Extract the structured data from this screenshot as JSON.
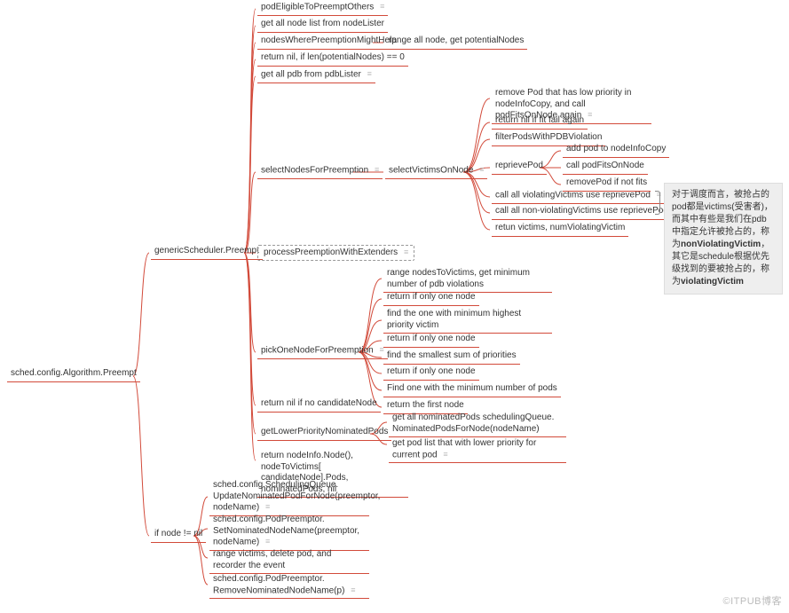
{
  "root": {
    "label": "sched.config.Algorithm.Preempt"
  },
  "level1": {
    "generic": {
      "label": "genericScheduler.Preempt"
    },
    "ifnode": {
      "label": "if node != nil"
    }
  },
  "generic_children": {
    "podEligible": "podEligibleToPreemptOthers",
    "getNodeList": "get all node list from nodeLister",
    "nodesWhere": "nodesWherePreemptionMightHelp",
    "nodesWhere_side": "range all node, get potentialNodes",
    "returnNilLen": "return nil, if len(potentialNodes) == 0",
    "getPdb": "get all pdb from pdbLister",
    "selectNodes": "selectNodesForPreemption",
    "processPreemption": "processPreemptionWithExtenders",
    "pickOne": "pickOneNodeForPreemption",
    "returnNilCandidate": "return nil if no candidateNode",
    "getLower": "getLowerPriorityNominatedPods",
    "returnNodeInfo": "return nodeInfo.Node(), nodeToVictims[\ncandidateNode].Pods, nominatedPods, nil"
  },
  "selectVictims": {
    "label": "selectVictimsOnNode",
    "children": {
      "removePod": "remove Pod that has low priority in\nnodeInfoCopy, and call podFitsOnNode again",
      "returnNil": "return nil if fit fail again",
      "filterPods": "filterPodsWithPDBViolation",
      "reprievePod": "reprievePod",
      "callViolating": "call all violatingVictims  use reprievePod",
      "callNonViolating": "call all non-violatingVictims use reprievePod",
      "returnVictims": "retun victims, numViolatingVictim"
    }
  },
  "reprievePod_children": {
    "addPod": "add pod to nodeInfoCopy",
    "callFits": "call podFitsOnNode",
    "removeIfNot": "removePod if not fits"
  },
  "pickOne_children": {
    "rangeNodes": "range nodesToVictims, get minimum number\nof pdb violations",
    "ret1": "return if only one  node",
    "findMinHigh": "find the one with minimum highest priority\nvictim",
    "ret2": "return if only one node",
    "findSmallSum": "find the smallest sum of priorities",
    "ret3": "return if only one node",
    "findMinPods": "Find one with the minimum number of pods",
    "retFirst": "return the first node"
  },
  "getLower_children": {
    "getNominated": "get all nominatedPods schedulingQueue.\nNominatedPodsForNode(nodeName)",
    "getPodList": "get pod list that with lower priority for current\npod"
  },
  "ifnode_children": {
    "updateNominated": "sched.config.SchedulingQueue.\nUpdateNominatedPodForNode(preemptor,\nnodeName)",
    "setNominated": "sched.config.PodPreemptor.\nSetNominatedNodeName(preemptor,\nnodeName)",
    "rangeVictims": "range victims, delete pod, and recorder the\nevent",
    "removeNominated": "sched.config.PodPreemptor.\nRemoveNominatedNodeName(p)"
  },
  "annotation": {
    "text_prefix": "对于调度而言，被抢占的pod都是victims(受害者)，而其中有些是我们在pdb中指定允许被抢占的，称为",
    "non_violating": "nonViolatingVictim",
    "mid": "，其它是schedule根据优先级找到的要被抢占的，称为",
    "violating": "violatingVictim"
  },
  "watermark": "©ITPUB博客"
}
